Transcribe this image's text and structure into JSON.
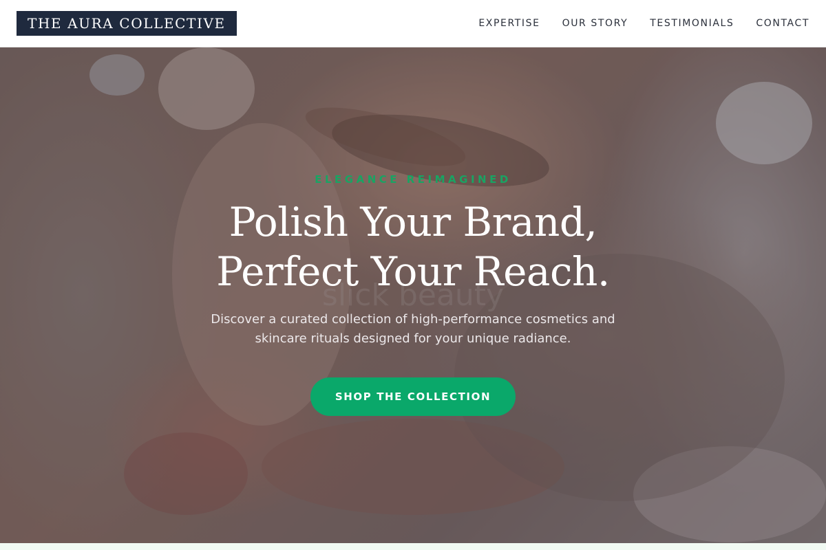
{
  "brand": {
    "name": "THE AURA COLLECTIVE"
  },
  "nav": {
    "items": [
      {
        "label": "EXPERTISE"
      },
      {
        "label": "OUR STORY"
      },
      {
        "label": "TESTIMONIALS"
      },
      {
        "label": "CONTACT"
      }
    ]
  },
  "hero": {
    "eyebrow": "ELEGANCE REIMAGINED",
    "headline_line1": "Polish Your Brand,",
    "headline_line2": "Perfect Your Reach.",
    "background_text": "slick beauty",
    "subtitle": "Discover a curated collection of high-performance cosmetics and skincare rituals designed for your unique radiance.",
    "cta_label": "SHOP THE COLLECTION"
  },
  "colors": {
    "brand_navy": "#1f2a3e",
    "accent_green": "#0aa86a",
    "eyebrow_green": "#19a463",
    "nav_text": "#2a2f3a"
  }
}
